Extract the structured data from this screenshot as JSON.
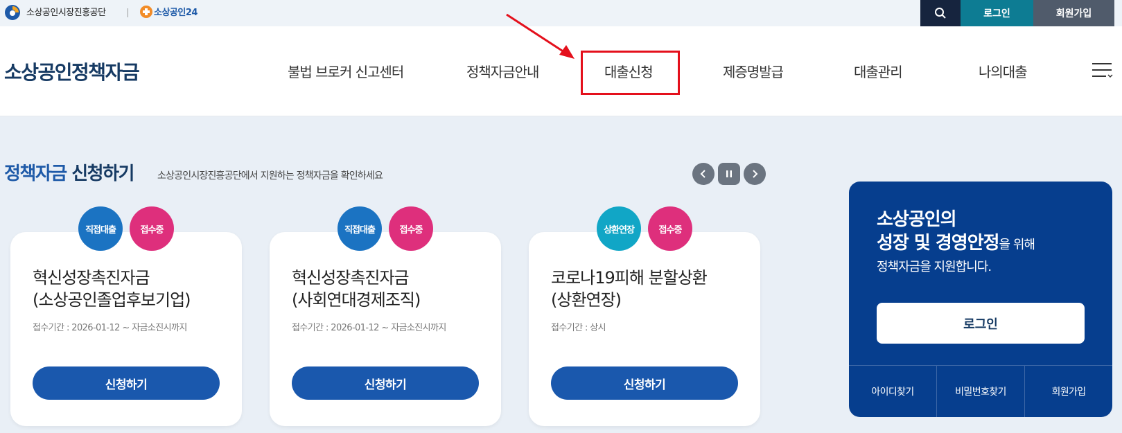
{
  "topbar": {
    "org_name": "소상공인시장진흥공단",
    "sb24_name": "소상공인24",
    "login_label": "로그인",
    "join_label": "회원가입"
  },
  "header": {
    "site_title": "소상공인정책자금",
    "nav": [
      {
        "label": "불법 브로커 신고센터"
      },
      {
        "label": "정책자금안내"
      },
      {
        "label": "대출신청",
        "highlighted": true
      },
      {
        "label": "제증명발급"
      },
      {
        "label": "대출관리"
      },
      {
        "label": "나의대출"
      }
    ]
  },
  "section": {
    "title_accent": "정책자금",
    "title_rest": " 신청하기",
    "subtitle": "소상공인시장진흥공단에서 지원하는 정책자금을 확인하세요"
  },
  "cards": [
    {
      "badges": [
        "직접대출",
        "접수중"
      ],
      "title_line1": "혁신성장촉진자금",
      "title_line2": "(소상공인졸업후보기업)",
      "period": "접수기간 : 2026-01-12 ~ 자금소진시까지",
      "button": "신청하기"
    },
    {
      "badges": [
        "직접대출",
        "접수중"
      ],
      "title_line1": "혁신성장촉진자금",
      "title_line2": "(사회연대경제조직)",
      "period": "접수기간 : 2026-01-12 ~ 자금소진시까지",
      "button": "신청하기"
    },
    {
      "badges": [
        "상환연장",
        "접수중"
      ],
      "title_line1": "코로나19피해 분할상환",
      "title_line2": "(상환연장)",
      "period": "접수기간 : 상시",
      "button": "신청하기"
    }
  ],
  "login_panel": {
    "line1": "소상공인의",
    "line2_bold": "성장 및 경영안정",
    "line2_small": "을 위해",
    "line3": "정책자금을 지원합니다.",
    "login_button": "로그인",
    "links": [
      "아이디찾기",
      "비밀번호찾기",
      "회원가입"
    ]
  },
  "colors": {
    "brand_navy": "#163a63",
    "primary_blue": "#1a58ad",
    "panel_blue": "#063e8e",
    "badge_blue": "#1b73c2",
    "badge_pink": "#de2f7c",
    "badge_teal": "#11a6c6",
    "highlight_red": "#e4101c"
  }
}
